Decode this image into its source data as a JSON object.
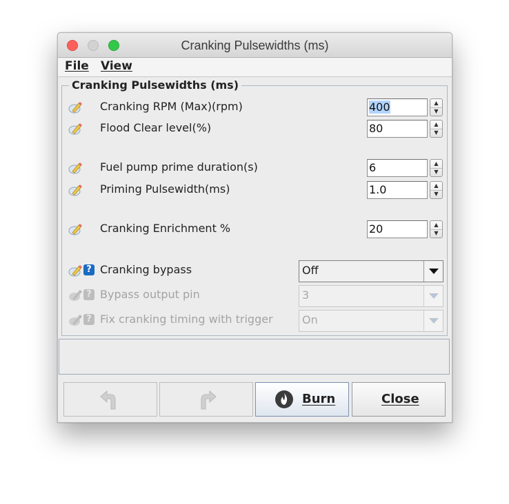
{
  "window": {
    "title": "Cranking Pulsewidths (ms)"
  },
  "menu": {
    "file": "File",
    "view": "View"
  },
  "group": {
    "title": "Cranking Pulsewidths (ms)"
  },
  "fields": [
    {
      "label": "Cranking RPM (Max)(rpm)",
      "value": "400",
      "selected": true
    },
    {
      "label": "Flood Clear level(%)",
      "value": "80"
    },
    {
      "label": "Fuel pump prime duration(s)",
      "value": "6"
    },
    {
      "label": "Priming Pulsewidth(ms)",
      "value": "1.0"
    },
    {
      "label": "Cranking Enrichment %",
      "value": "20"
    }
  ],
  "dropdowns": [
    {
      "label": "Cranking bypass",
      "value": "Off",
      "enabled": true
    },
    {
      "label": "Bypass output pin",
      "value": "3",
      "enabled": false
    },
    {
      "label": "Fix cranking timing with trigger",
      "value": "On",
      "enabled": false
    }
  ],
  "buttons": {
    "burn": "Burn",
    "close": "Close"
  },
  "icons": {
    "undo": "undo-arrow-icon",
    "redo": "redo-arrow-icon",
    "burn": "flame-icon",
    "edit": "pencil-edit-icon",
    "help": "help-icon"
  },
  "colors": {
    "help_blue": "#1a6bc1",
    "close_red": "#fc605c",
    "maximize_green": "#34c84a"
  }
}
